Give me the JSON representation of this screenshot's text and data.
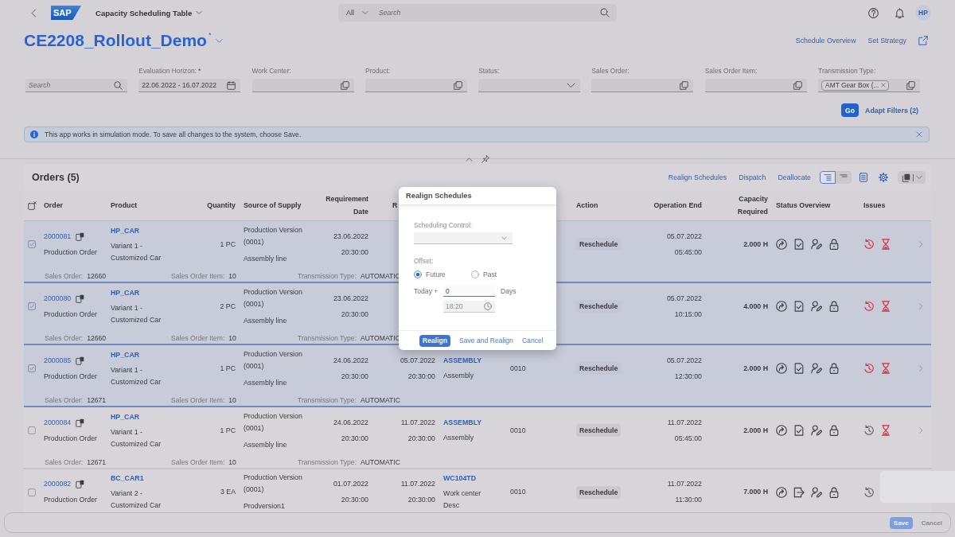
{
  "shell": {
    "logo": "SAP",
    "title": "Capacity Scheduling Table",
    "search_scope": "All",
    "search_placeholder": "Search",
    "user_initials": "HP"
  },
  "header": {
    "title": "CE2208_Rollout_Demo",
    "modified_mark": "*",
    "links": [
      "Schedule Overview",
      "Set Strategy"
    ]
  },
  "filters": {
    "search_placeholder": "Search",
    "fields": [
      {
        "label": "Evaluation Horizon:",
        "required_mark": "*",
        "kind": "date",
        "value": "22.06.2022 - 16.07.2022"
      },
      {
        "label": "Work Center:",
        "kind": "valuehelp"
      },
      {
        "label": "Product:",
        "kind": "valuehelp"
      },
      {
        "label": "Status:",
        "kind": "select"
      },
      {
        "label": "Sales Order:",
        "kind": "valuehelp"
      },
      {
        "label": "Sales Order Item:",
        "kind": "valuehelp"
      },
      {
        "label": "Transmission Type:",
        "kind": "valuehelp",
        "tokens": [
          "AMT Gear Box (..."
        ]
      }
    ],
    "go": "Go",
    "adapt": "Adapt Filters (2)"
  },
  "message": {
    "text": "This app works in simulation mode. To save all changes to the system, choose Save."
  },
  "orders": {
    "title": "Orders (5)",
    "actions": [
      "Realign Schedules",
      "Dispatch",
      "Deallocate"
    ],
    "view_modes": [
      {
        "kind": "tree",
        "selected": true
      },
      {
        "kind": "flat",
        "selected": false
      }
    ],
    "columns": [
      "Order",
      "Product",
      "Quantity",
      "Source of Supply",
      "Requirement Date",
      "R",
      "Action",
      "Operation End",
      "Capacity Required",
      "Status Overview",
      "Issues"
    ],
    "rows": [
      {
        "selected": true,
        "order": "2000081",
        "order_type": "Production Order",
        "product": "HP_CAR",
        "product_description": "Variant 1 - Customized Car",
        "quantity": "1 PC",
        "source": "Production Version (0001)",
        "source_detail": "Assembly line",
        "requirement_date": "23.06.2022",
        "requirement_time": "20:30:00",
        "action": "Reschedule",
        "operation_end_date": "05.07.2022",
        "operation_end_time": "05:45:00",
        "capacity": "2.000 H",
        "status": [
          {
            "kind": "circlearrow"
          },
          {
            "kind": "doccheck"
          },
          {
            "kind": "useredit"
          },
          {
            "kind": "lock"
          }
        ],
        "issues": [
          {
            "kind": "history",
            "alert": true
          },
          {
            "kind": "hourglass",
            "alert": true
          }
        ],
        "navigable": true,
        "details": [
          {
            "label": "Sales Order:",
            "value": "12660"
          },
          {
            "label": "Sales Order Item:",
            "value": "10"
          },
          {
            "label": "Transmission Type:",
            "value": "AUTOMATIC"
          }
        ]
      },
      {
        "selected": true,
        "order": "2000080",
        "order_type": "Production Order",
        "product": "HP_CAR",
        "product_description": "Variant 1 - Customized Car",
        "quantity": "2 PC",
        "source": "Production Version (0001)",
        "source_detail": "Assembly line",
        "requirement_date": "23.06.2022",
        "requirement_time": "20:30:00",
        "action": "Reschedule",
        "operation_end_date": "05.07.2022",
        "operation_end_time": "10:15:00",
        "capacity": "4.000 H",
        "status": [
          {
            "kind": "circlearrow"
          },
          {
            "kind": "doccheck"
          },
          {
            "kind": "useredit"
          },
          {
            "kind": "lock"
          }
        ],
        "issues": [
          {
            "kind": "history",
            "alert": true
          },
          {
            "kind": "hourglass",
            "alert": true
          }
        ],
        "navigable": true,
        "details": [
          {
            "label": "Sales Order:",
            "value": "12660"
          },
          {
            "label": "Sales Order Item:",
            "value": "10"
          },
          {
            "label": "Transmission Type:",
            "value": "AUTOMATIC"
          }
        ]
      },
      {
        "selected": true,
        "order": "2000085",
        "order_type": "Production Order",
        "product": "HP_CAR",
        "product_description": "Variant 1 - Customized Car",
        "quantity": "1 PC",
        "source": "Production Version (0001)",
        "source_detail": "Assembly line",
        "requirement_date": "24.06.2022",
        "requirement_time": "20:30:00",
        "column_6": {
          "date": "05.07.2022",
          "time": "20:30:00"
        },
        "column_7": {
          "code": "ASSEMBLY",
          "text": "Assembly"
        },
        "column_8": "0010",
        "action": "Reschedule",
        "operation_end_date": "05.07.2022",
        "operation_end_time": "12:30:00",
        "capacity": "2.000 H",
        "status": [
          {
            "kind": "circlearrow"
          },
          {
            "kind": "doccheck"
          },
          {
            "kind": "useredit"
          },
          {
            "kind": "lock"
          }
        ],
        "issues": [
          {
            "kind": "history",
            "alert": true
          },
          {
            "kind": "hourglass",
            "alert": true
          }
        ],
        "navigable": true,
        "details": [
          {
            "label": "Sales Order:",
            "value": "12671"
          },
          {
            "label": "Sales Order Item:",
            "value": "10"
          },
          {
            "label": "Transmission Type:",
            "value": "AUTOMATIC"
          }
        ]
      },
      {
        "selected": false,
        "order": "2000084",
        "order_type": "Production Order",
        "product": "HP_CAR",
        "product_description": "Variant 1 - Customized Car",
        "quantity": "1 PC",
        "source": "Production Version (0001)",
        "source_detail": "Assembly line",
        "requirement_date": "24.06.2022",
        "requirement_time": "20:30:00",
        "column_6": {
          "date": "11.07.2022",
          "time": "20:30:00"
        },
        "column_7": {
          "code": "ASSEMBLY",
          "text": "Assembly"
        },
        "column_8": "0010",
        "action": "Reschedule",
        "operation_end_date": "11.07.2022",
        "operation_end_time": "05:45:00",
        "capacity": "2.000 H",
        "status": [
          {
            "kind": "circlearrow"
          },
          {
            "kind": "doccheck"
          },
          {
            "kind": "useredit"
          },
          {
            "kind": "lock"
          }
        ],
        "issues": [
          {
            "kind": "history",
            "alert": false
          },
          {
            "kind": "hourglass",
            "alert": true
          }
        ],
        "navigable": true,
        "details": [
          {
            "label": "Sales Order:",
            "value": "12671"
          },
          {
            "label": "Sales Order Item:",
            "value": "10"
          },
          {
            "label": "Transmission Type:",
            "value": "AUTOMATIC"
          }
        ]
      },
      {
        "selected": false,
        "order": "2000082",
        "order_type": "Production Order",
        "product": "BC_CAR1",
        "product_description": "Variant 2 - Customized Car",
        "quantity": "3 EA",
        "source": "Production Version (0001)",
        "source_detail": "Prodversion1",
        "requirement_date": "01.07.2022",
        "requirement_time": "20:30:00",
        "column_6": {
          "date": "11.07.2022",
          "time": "20:30:00"
        },
        "column_7": {
          "code": "WC104TD",
          "text": "Work center Desc"
        },
        "column_8": "0010",
        "action": "Reschedule",
        "operation_end_date": "11.07.2022",
        "operation_end_time": "11:30:00",
        "capacity": "7.000 H",
        "status": [
          {
            "kind": "circlearrow"
          },
          {
            "kind": "docexit"
          },
          {
            "kind": "useredit"
          },
          {
            "kind": "lock"
          }
        ],
        "issues": [
          {
            "kind": "history",
            "alert": false
          }
        ],
        "navigable": false
      }
    ]
  },
  "dialog": {
    "title": "Realign Schedules",
    "control_label": "Scheduling Control:",
    "offset_label": "Offset:",
    "offset_options": [
      {
        "label": "Future",
        "selected": true
      },
      {
        "label": "Past",
        "selected": false
      }
    ],
    "today_label": "Today +",
    "days_value": "0",
    "days_unit": "Days",
    "time_value": "18:20",
    "buttons": [
      {
        "label": "Realign",
        "kind": "emphasized"
      },
      {
        "label": "Save and Realign",
        "kind": "transparent"
      },
      {
        "label": "Cancel",
        "kind": "transparent"
      }
    ]
  },
  "footer": {
    "buttons": [
      {
        "label": "Save",
        "kind": "emphasized",
        "disabled": true
      },
      {
        "label": "Cancel",
        "kind": "transparent",
        "disabled": true
      }
    ]
  }
}
